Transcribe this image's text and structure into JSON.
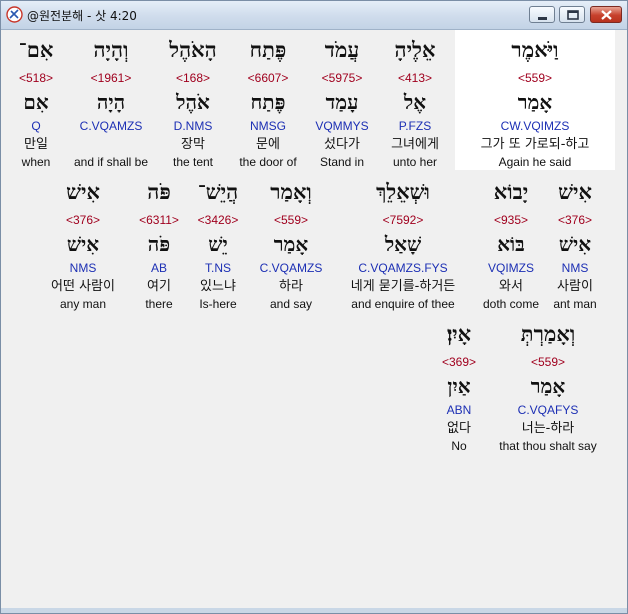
{
  "window": {
    "title": "@원전분해 - 삿 4:20",
    "controls": {
      "minimize": "minimize-icon",
      "maximize": "maximize-icon",
      "close": "close-icon"
    }
  },
  "rows": [
    {
      "words": [
        {
          "hebrew": "וַיֹּאמֶר",
          "strong": "<559>",
          "lexeme": "אָמַר",
          "parsing": "CW.VQIMZS",
          "korean": "그가 또 가로되-하고",
          "english": "Again he said",
          "highlighted": true
        },
        {
          "hebrew": "אֵלֶיהָ",
          "strong": "<413>",
          "lexeme": "אֶל",
          "parsing": "P.FZS",
          "korean": "그녀에게",
          "english": "unto her"
        },
        {
          "hebrew": "עֲמֹד",
          "strong": "<5975>",
          "lexeme": "עָמַד",
          "parsing": "VQMMYS",
          "korean": "섰다가",
          "english": "Stand in"
        },
        {
          "hebrew": "פֶּתַח",
          "strong": "<6607>",
          "lexeme": "פֶּתַח",
          "parsing": "NMSG",
          "korean": "문에",
          "english": "the door of"
        },
        {
          "hebrew": "הָאֹהֶל",
          "strong": "<168>",
          "lexeme": "אֹהֶל",
          "parsing": "D.NMS",
          "korean": "장막",
          "english": "the tent"
        },
        {
          "hebrew": "וְהָיָה",
          "strong": "<1961>",
          "lexeme": "הָיָה",
          "parsing": "C.VQAMZS",
          "korean": "",
          "english": "and if shall be"
        },
        {
          "hebrew": "אִם־",
          "strong": "<518>",
          "lexeme": "אִם",
          "parsing": "Q",
          "korean": "만일",
          "english": "when"
        }
      ]
    },
    {
      "words": [
        {
          "hebrew": "אִישׁ",
          "strong": "<376>",
          "lexeme": "אִישׁ",
          "parsing": "NMS",
          "korean": "사람이",
          "english": "ant man"
        },
        {
          "hebrew": "יָבוֹא",
          "strong": "<935>",
          "lexeme": "בּוֹא",
          "parsing": "VQIMZS",
          "korean": "와서",
          "english": "doth come"
        },
        {
          "hebrew": "וּשְׁאֵלֵךְ",
          "strong": "<7592>",
          "lexeme": "שָׁאַל",
          "parsing": "C.VQAMZS.FYS",
          "korean": "네게 묻기를-하거든",
          "english": "and enquire of thee"
        },
        {
          "hebrew": "וְאָמַר",
          "strong": "<559>",
          "lexeme": "אָמַר",
          "parsing": "C.VQAMZS",
          "korean": "하라",
          "english": "and say"
        },
        {
          "hebrew": "הֲיֵשׁ־",
          "strong": "<3426>",
          "lexeme": "יֵשׁ",
          "parsing": "T.NS",
          "korean": "있느냐",
          "english": "Is-here"
        },
        {
          "hebrew": "פֹּה",
          "strong": "<6311>",
          "lexeme": "פֹּה",
          "parsing": "AB",
          "korean": "여기",
          "english": "there"
        },
        {
          "hebrew": "אִישׁ",
          "strong": "<376>",
          "lexeme": "אִישׁ",
          "parsing": "NMS",
          "korean": "어떤 사람이",
          "english": "any man"
        }
      ]
    },
    {
      "words": [
        {
          "hebrew": "וְאָמַרְתְּ",
          "strong": "<559>",
          "lexeme": "אָמַר",
          "parsing": "C.VQAFYS",
          "korean": "너는-하라",
          "english": "that thou shalt say"
        },
        {
          "hebrew": "אָיִן׃",
          "strong": "<369>",
          "lexeme": "אַיִן",
          "parsing": "ABN",
          "korean": "없다",
          "english": "No"
        }
      ]
    }
  ]
}
